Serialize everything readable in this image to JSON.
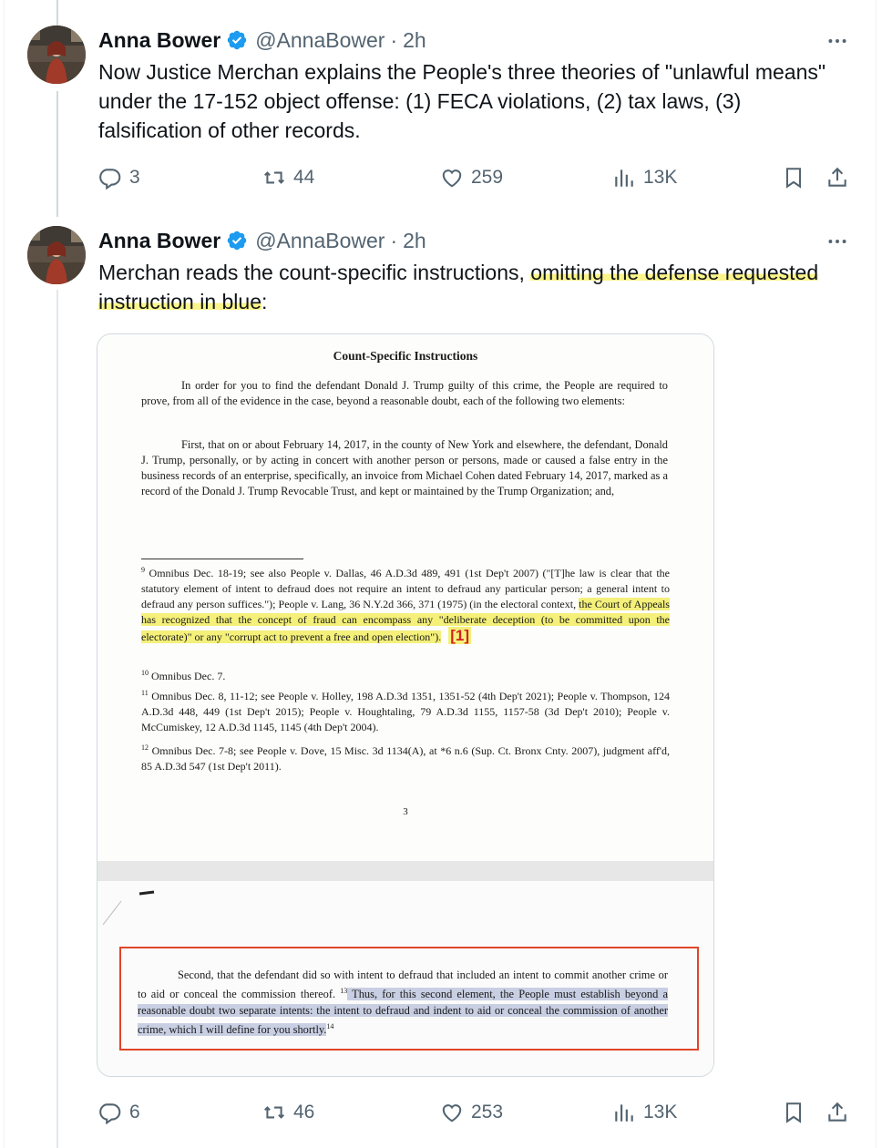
{
  "tweets": [
    {
      "author": {
        "name": "Anna Bower",
        "handle": "@AnnaBower",
        "time": "2h",
        "separator": "·"
      },
      "text": "Now Justice Merchan explains the People's three theories of \"unlawful means\" under the 17-152 object offense: (1) FECA violations, (2) tax laws, (3) falsification of other records.",
      "actions": {
        "replies": "3",
        "reposts": "44",
        "likes": "259",
        "views": "13K"
      }
    },
    {
      "author": {
        "name": "Anna Bower",
        "handle": "@AnnaBower",
        "time": "2h",
        "separator": "·"
      },
      "text_plain_1": "Merchan reads the count-specific instructions, ",
      "text_highlight": "omitting the defense requested instruction in blue",
      "text_plain_2": ":",
      "actions": {
        "replies": "6",
        "reposts": "46",
        "likes": "253",
        "views": "13K"
      }
    }
  ],
  "document": {
    "heading": "Count-Specific Instructions",
    "para1": "In order for you to find the defendant Donald J. Trump guilty of this crime, the People are required to prove, from all of the evidence in the case, beyond a reasonable doubt, each of the following two elements:",
    "para2": "First, that on or about February 14, 2017, in the county of New York and elsewhere, the defendant, Donald J. Trump, personally, or by acting in concert with another person or persons, made or caused a false entry in the business records of an enterprise, specifically, an invoice from Michael Cohen dated February 14, 2017, marked as a record of the Donald J. Trump Revocable Trust, and kept or maintained by the Trump Organization; and,",
    "fn9_num": "9",
    "fn9_a": "Omnibus Dec. 18-19; see also People v. Dallas, 46 A.D.3d 489, 491 (1st Dep't 2007) (\"[T]he law is clear that the statutory element of intent to defraud does not require an intent to defraud any particular person; a general intent to defraud any person suffices.\"); People v. Lang, 36 N.Y.2d 366, 371 (1975) (in the electoral context, ",
    "fn9_hl": "the Court of Appeals has recognized that the concept of fraud can encompass any \"deliberate deception (to be committed upon the electorate)\" or any \"corrupt act to prevent a free and open election\").",
    "fn9_ref": "[1]",
    "fn10_num": "10",
    "fn10": "Omnibus Dec. 7.",
    "fn11_num": "11",
    "fn11": "Omnibus Dec. 8, 11-12; see People v. Holley, 198 A.D.3d 1351, 1351-52 (4th Dep't 2021); People v. Thompson, 124 A.D.3d 448, 449 (1st Dep't 2015); People v. Houghtaling, 79 A.D.3d 1155, 1157-58 (3d Dep't 2010); People v. McCumiskey, 12 A.D.3d 1145, 1145 (4th Dep't 2004).",
    "fn12_num": "12",
    "fn12": "Omnibus Dec. 7-8; see People v. Dove, 15 Misc. 3d 1134(A), at *6 n.6 (Sup. Ct. Bronx Cnty. 2007), judgment aff'd, 85 A.D.3d 547 (1st Dep't 2011).",
    "page_number": "3",
    "second_a": "Second, that the defendant did so with intent to defraud that included an intent to commit another crime or to aid or conceal the commission thereof.",
    "second_fn": "13",
    "second_blue": " Thus, for this second element, the People must establish beyond a reasonable doubt two separate intents: the intent to defraud and indent to aid or conceal the commission of another crime, which I will define for you shortly.",
    "second_fn2": "14"
  },
  "colors": {
    "highlight": "#fbf48a",
    "blue_highlight": "#c9cfe3",
    "red_box": "#e0452b",
    "verified": "#1d9bf0",
    "muted": "#536471"
  },
  "icons": [
    "reply-icon",
    "repost-icon",
    "like-icon",
    "views-icon",
    "bookmark-icon",
    "share-icon",
    "verified-badge-icon",
    "more-icon"
  ]
}
